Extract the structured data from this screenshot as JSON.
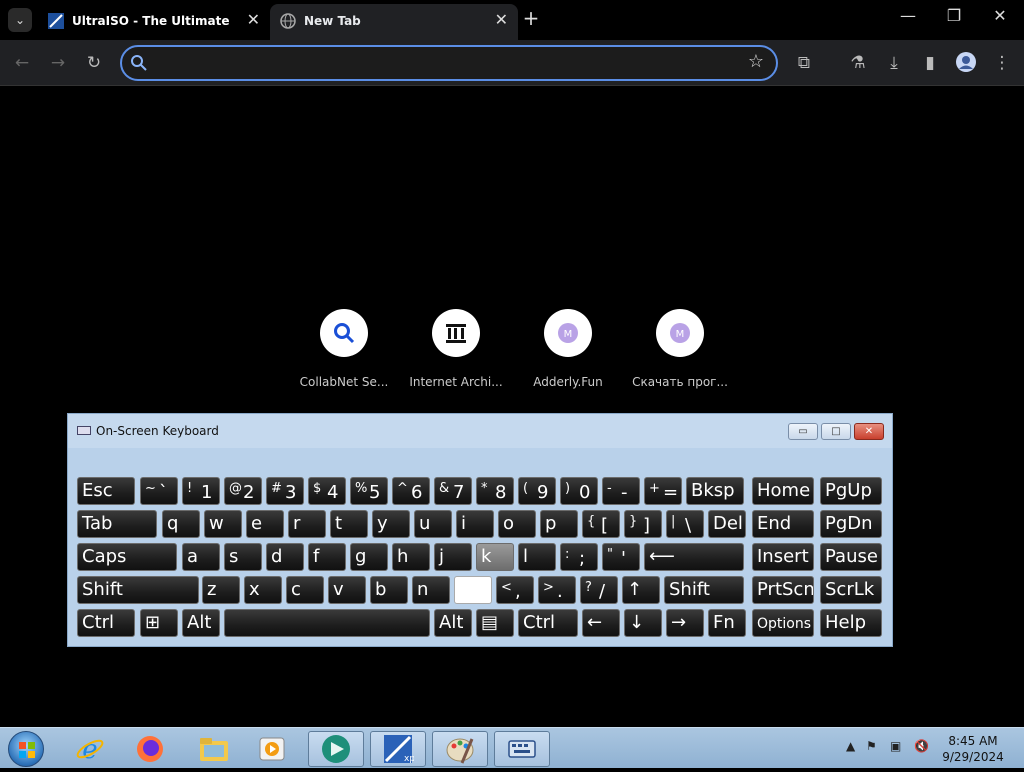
{
  "browser": {
    "tabs": [
      {
        "title": "UltraISO - The Ultimate ISO CD",
        "favicon": "ultraiso-icon",
        "close": "✕"
      },
      {
        "title": "New Tab",
        "favicon": "globe-icon",
        "close": "✕"
      }
    ],
    "new_tab": "+",
    "window_controls": {
      "minimize": "—",
      "restore": "❐",
      "close": "✕"
    },
    "omnibox": {
      "value": "",
      "placeholder": ""
    },
    "toolbar_icons": [
      "back-icon",
      "forward-icon",
      "reload-icon",
      "star-icon",
      "extensions-icon",
      "labs-icon",
      "download-icon",
      "sidepanel-icon",
      "profile-icon",
      "menu-icon"
    ]
  },
  "ntp": {
    "shortcuts": [
      {
        "label": "CollabNet Se...",
        "icon": "search-icon"
      },
      {
        "label": "Internet Archi...",
        "icon": "archive-icon"
      },
      {
        "label": "Adderly.Fun",
        "icon": "globe-icon"
      },
      {
        "label": "Скачать прог...",
        "icon": "globe-icon"
      }
    ]
  },
  "osk": {
    "title": "On-Screen Keyboard",
    "rows": [
      [
        {
          "main": "Esc"
        },
        {
          "sup": "~",
          "main": "`"
        },
        {
          "sup": "!",
          "main": "1"
        },
        {
          "sup": "@",
          "main": "2"
        },
        {
          "sup": "#",
          "main": "3"
        },
        {
          "sup": "$",
          "main": "4"
        },
        {
          "sup": "%",
          "main": "5"
        },
        {
          "sup": "^",
          "main": "6"
        },
        {
          "sup": "&",
          "main": "7"
        },
        {
          "sup": "*",
          "main": "8"
        },
        {
          "sup": "(",
          "main": "9"
        },
        {
          "sup": ")",
          "main": "0"
        },
        {
          "sup": "-",
          "main": "-"
        },
        {
          "sup": "+",
          "main": "="
        },
        {
          "main": "Bksp"
        },
        {
          "main": "Home"
        },
        {
          "main": "PgUp"
        }
      ],
      [
        {
          "main": "Tab"
        },
        {
          "main": "q"
        },
        {
          "main": "w"
        },
        {
          "main": "e"
        },
        {
          "main": "r"
        },
        {
          "main": "t"
        },
        {
          "main": "y"
        },
        {
          "main": "u"
        },
        {
          "main": "i"
        },
        {
          "main": "o"
        },
        {
          "main": "p"
        },
        {
          "sup": "{",
          "main": "["
        },
        {
          "sup": "}",
          "main": "]"
        },
        {
          "sup": "|",
          "main": "\\"
        },
        {
          "main": "Del"
        },
        {
          "main": "End"
        },
        {
          "main": "PgDn"
        }
      ],
      [
        {
          "main": "Caps"
        },
        {
          "main": "a"
        },
        {
          "main": "s"
        },
        {
          "main": "d"
        },
        {
          "main": "f"
        },
        {
          "main": "g"
        },
        {
          "main": "h"
        },
        {
          "main": "j"
        },
        {
          "main": "k"
        },
        {
          "main": "l"
        },
        {
          "sup": ":",
          "main": ";"
        },
        {
          "sup": "\"",
          "main": "'"
        },
        {
          "main": "⟵"
        },
        {
          "main": "Insert"
        },
        {
          "main": "Pause"
        }
      ],
      [
        {
          "main": "Shift"
        },
        {
          "main": "z"
        },
        {
          "main": "x"
        },
        {
          "main": "c"
        },
        {
          "main": "v"
        },
        {
          "main": "b"
        },
        {
          "main": "n"
        },
        {
          "main": ""
        },
        {
          "sup": "<",
          "main": ","
        },
        {
          "sup": ">",
          "main": "."
        },
        {
          "sup": "?",
          "main": "/"
        },
        {
          "main": "↑"
        },
        {
          "main": "Shift"
        },
        {
          "main": "PrtScn"
        },
        {
          "main": "ScrLk"
        }
      ],
      [
        {
          "main": "Ctrl"
        },
        {
          "main": "⊞"
        },
        {
          "main": "Alt"
        },
        {
          "main": ""
        },
        {
          "main": "Alt"
        },
        {
          "main": "▤"
        },
        {
          "main": "Ctrl"
        },
        {
          "main": "←"
        },
        {
          "main": "↓"
        },
        {
          "main": "→"
        },
        {
          "main": "Fn"
        },
        {
          "main": "Options"
        },
        {
          "main": "Help"
        }
      ]
    ]
  },
  "taskbar": {
    "apps": [
      "ie-icon",
      "firefox-icon",
      "explorer-icon",
      "media-icon",
      "app-icon",
      "vmware-icon",
      "paint-icon",
      "keyboard-icon"
    ],
    "time": "8:45 AM",
    "date": "9/29/2024"
  }
}
